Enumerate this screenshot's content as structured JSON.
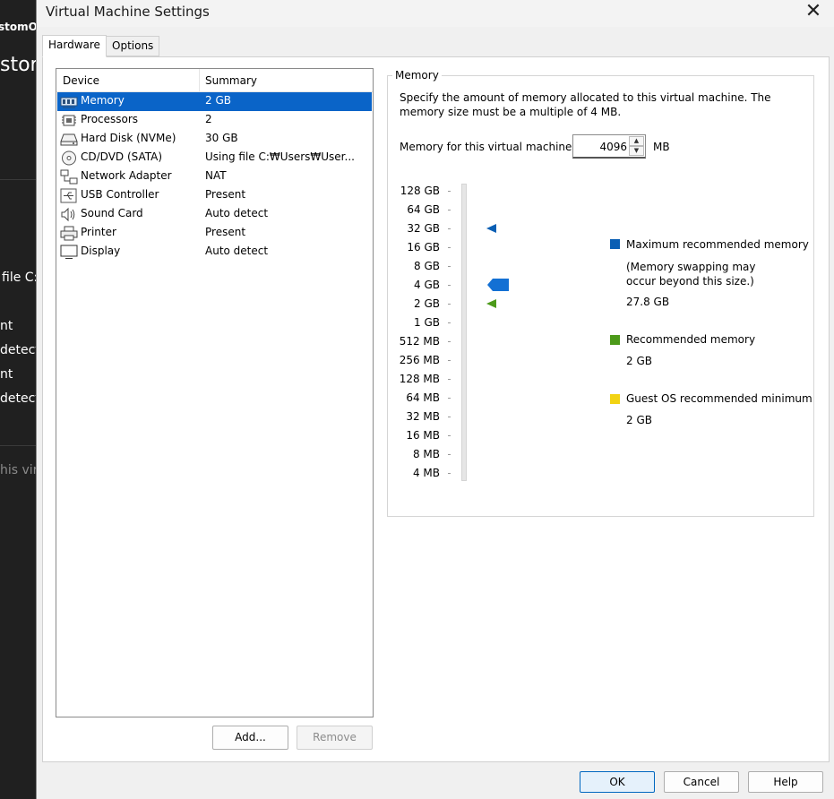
{
  "background_app": {
    "fragments": [
      "stomO",
      "stor",
      "file C:",
      "nt",
      "detect",
      "nt",
      "detect",
      "his virt"
    ]
  },
  "dialog": {
    "title": "Virtual Machine Settings",
    "close_glyph": "✕",
    "tabs": [
      {
        "label": "Hardware",
        "active": true
      },
      {
        "label": "Options",
        "active": false
      }
    ]
  },
  "device_list": {
    "headers": {
      "device": "Device",
      "summary": "Summary"
    },
    "items": [
      {
        "name": "Memory",
        "summary": "2 GB",
        "icon": "memory-icon",
        "selected": true
      },
      {
        "name": "Processors",
        "summary": "2",
        "icon": "processor-icon"
      },
      {
        "name": "Hard Disk (NVMe)",
        "summary": "30 GB",
        "icon": "hard-disk-icon"
      },
      {
        "name": "CD/DVD (SATA)",
        "summary": "Using file C:₩Users₩User...",
        "icon": "cd-dvd-icon"
      },
      {
        "name": "Network Adapter",
        "summary": "NAT",
        "icon": "network-adapter-icon"
      },
      {
        "name": "USB Controller",
        "summary": "Present",
        "icon": "usb-icon"
      },
      {
        "name": "Sound Card",
        "summary": "Auto detect",
        "icon": "speaker-icon"
      },
      {
        "name": "Printer",
        "summary": "Present",
        "icon": "printer-icon"
      },
      {
        "name": "Display",
        "summary": "Auto detect",
        "icon": "display-icon"
      }
    ],
    "add_label": "Add...",
    "remove_label": "Remove"
  },
  "memory": {
    "group_label": "Memory",
    "description": "Specify the amount of memory allocated to this virtual machine. The memory size must be a multiple of 4 MB.",
    "field_label": "Memory for this virtual machine:",
    "value": "4096",
    "unit": "MB",
    "slider_ticks": [
      "128 GB",
      "64 GB",
      "32 GB",
      "16 GB",
      "8 GB",
      "4 GB",
      "2 GB",
      "1 GB",
      "512 MB",
      "256 MB",
      "128 MB",
      "64 MB",
      "32 MB",
      "16 MB",
      "8 MB",
      "4 MB"
    ],
    "slider_value": "4 GB",
    "max_marker": "32 GB",
    "recommended_marker": "2 GB",
    "legend": {
      "max_title": "Maximum recommended memory",
      "max_note": "(Memory swapping may\noccur beyond this size.)",
      "max_value": "27.8 GB",
      "rec_title": "Recommended memory",
      "rec_value": "2 GB",
      "guest_title": "Guest OS recommended minimum",
      "guest_value": "2 GB"
    },
    "colors": {
      "max": "#0a5fb4",
      "recommended": "#4c9a1a",
      "guest": "#f2d313",
      "thumb": "#1370d4"
    }
  },
  "footer": {
    "ok_label": "OK",
    "cancel_label": "Cancel",
    "help_label": "Help"
  }
}
